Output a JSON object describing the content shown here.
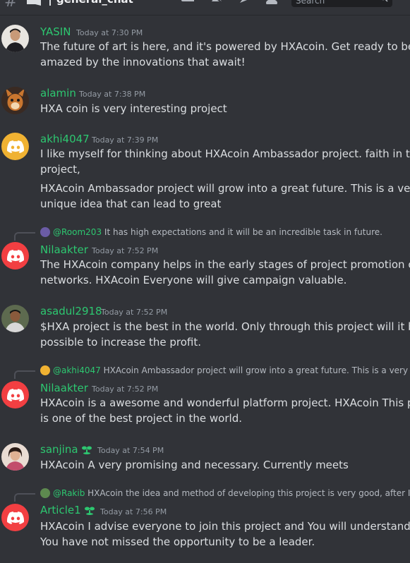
{
  "header": {
    "channel_name": "general_chat",
    "search_placeholder": "Search"
  },
  "colors": {
    "background": "#313338",
    "username_green": "#2dc770",
    "discord_red": "#f23f42",
    "discord_orange": "#f0b232"
  },
  "messages": [
    {
      "username": "YASIN",
      "timestamp": "Today at 7:30 PM",
      "lines": [
        "The future of art is here, and it's powered by HXAcoin. Get ready to be",
        "amazed by the innovations that await!"
      ]
    },
    {
      "username": "alamin",
      "timestamp": "Today at 7:38 PM",
      "lines": [
        "HXA coin is very interesting project"
      ]
    },
    {
      "username": "akhi4047",
      "timestamp": "Today at 7:39 PM",
      "lines": [
        "I like myself for thinking about HXAcoin Ambassador project. faith in this",
        "project,",
        "HXAcoin Ambassador project will grow into a great future.  This is a very",
        "unique idea that can lead to great"
      ]
    },
    {
      "reply_author": "@Room203",
      "reply_text": "It has high expectations and it will be an incredible task in future.",
      "username": "Nilaakter",
      "timestamp": "Today at 7:52 PM",
      "lines": [
        "The HXAcoin company helps in the early stages of project promotion on social",
        "networks. HXAcoin Everyone will give campaign  valuable."
      ]
    },
    {
      "username": "asadul2918",
      "timestamp": "Today at 7:52 PM",
      "lines": [
        "$HXA project is the best in the world. Only through this project will it be",
        "possible to increase the profit."
      ]
    },
    {
      "reply_author": "@akhi4047",
      "reply_text": "HXAcoin Ambassador project will grow into a great future. This is a very u",
      "username": "Nilaakter",
      "timestamp": "Today at 7:52 PM",
      "lines": [
        "HXAcoin is a awesome and wonderful platform project. HXAcoin This project",
        "is one of the best project in the world."
      ]
    },
    {
      "username": "sanjina",
      "timestamp": "Today at 7:54 PM",
      "lines": [
        "HXAcoin A very promising and necessary. Currently meets"
      ]
    },
    {
      "reply_author": "@Rakib",
      "reply_text": "HXAcoin the idea and method of developing this project is very good, after I d",
      "username": "Article1",
      "timestamp": "Today at 7:56 PM",
      "lines": [
        "HXAcoin I advise everyone to join this project and You will understand that",
        "You have not missed the opportunity to be a leader."
      ]
    }
  ]
}
